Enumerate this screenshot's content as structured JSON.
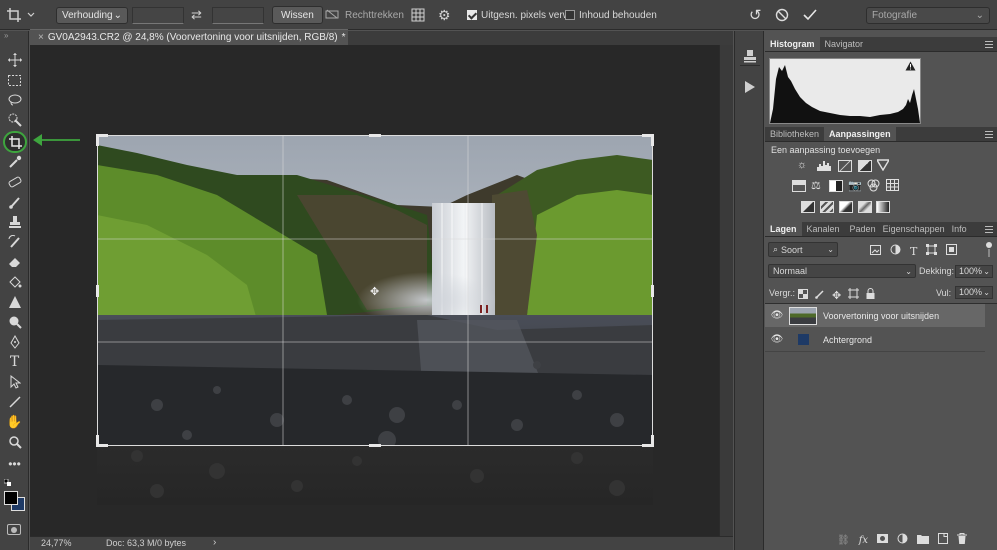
{
  "options_bar": {
    "ratio_select": "Verhouding",
    "clear_button": "Wissen",
    "straighten_label": "Rechttrekken",
    "delete_pixels_label": "Uitgesn. pixels verw.",
    "delete_pixels_checked": true,
    "content_aware_label": "Inhoud behouden",
    "content_aware_checked": false,
    "workspace": "Fotografie"
  },
  "document": {
    "tab_title": "GV0A2943.CR2 @ 24,8% (Voorvertoning voor uitsnijden, RGB/8)",
    "modified_marker": "*",
    "zoom": "24,77%",
    "doc_info": "Doc: 63,3 M/0 bytes"
  },
  "panels": {
    "histogram_tabs": [
      "Histogram",
      "Navigator"
    ],
    "library_tabs": [
      "Bibliotheken",
      "Aanpassingen"
    ],
    "adjustments_title": "Een aanpassing toevoegen",
    "layers_tabs": [
      "Lagen",
      "Kanalen",
      "Paden",
      "Eigenschappen",
      "Info"
    ],
    "filter_select": "Soort",
    "blend_mode": "Normaal",
    "opacity_label": "Dekking:",
    "opacity_value": "100%",
    "lock_label": "Vergr.:",
    "fill_label": "Vul:",
    "fill_value": "100%",
    "layers": [
      {
        "name": "Voorvertoning voor uitsnijden",
        "selected": true,
        "visible": true
      },
      {
        "name": "Achtergrond",
        "selected": false,
        "visible": true
      }
    ]
  },
  "colors": {
    "foreground": "#000000",
    "background": "#1e3a66",
    "arrow_annotation": "#3ea53e"
  }
}
